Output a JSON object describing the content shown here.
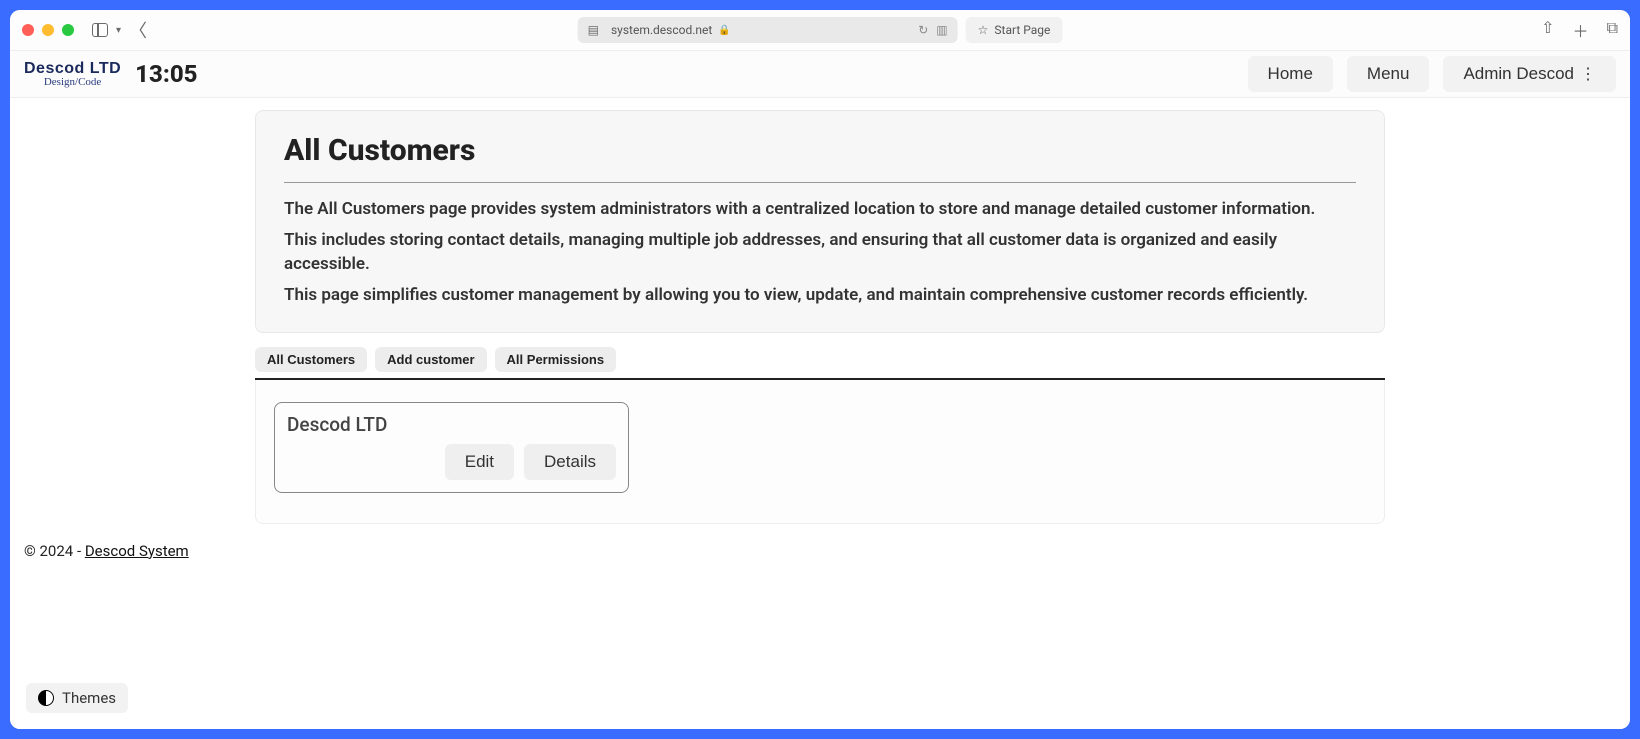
{
  "browser": {
    "url": "system.descod.net",
    "start_page_label": "Start Page"
  },
  "header": {
    "logo_main": "Descod LTD",
    "logo_sub": "Design/Code",
    "clock": "13:05",
    "nav": {
      "home": "Home",
      "menu": "Menu",
      "admin": "Admin Descod"
    }
  },
  "page": {
    "title": "All Customers",
    "desc1": "The All Customers page provides system administrators with a centralized location to store and manage detailed customer information.",
    "desc2": "This includes storing contact details, managing multiple job addresses, and ensuring that all customer data is organized and easily accessible.",
    "desc3": "This page simplifies customer management by allowing you to view, update, and maintain comprehensive customer records efficiently."
  },
  "tabs": {
    "all_customers": "All Customers",
    "add_customer": "Add customer",
    "all_permissions": "All Permissions"
  },
  "customers": [
    {
      "name": "Descod LTD"
    }
  ],
  "buttons": {
    "edit": "Edit",
    "details": "Details"
  },
  "footer": {
    "copyright": "© 2024 - ",
    "link_text": "Descod System"
  },
  "themes_label": "Themes"
}
